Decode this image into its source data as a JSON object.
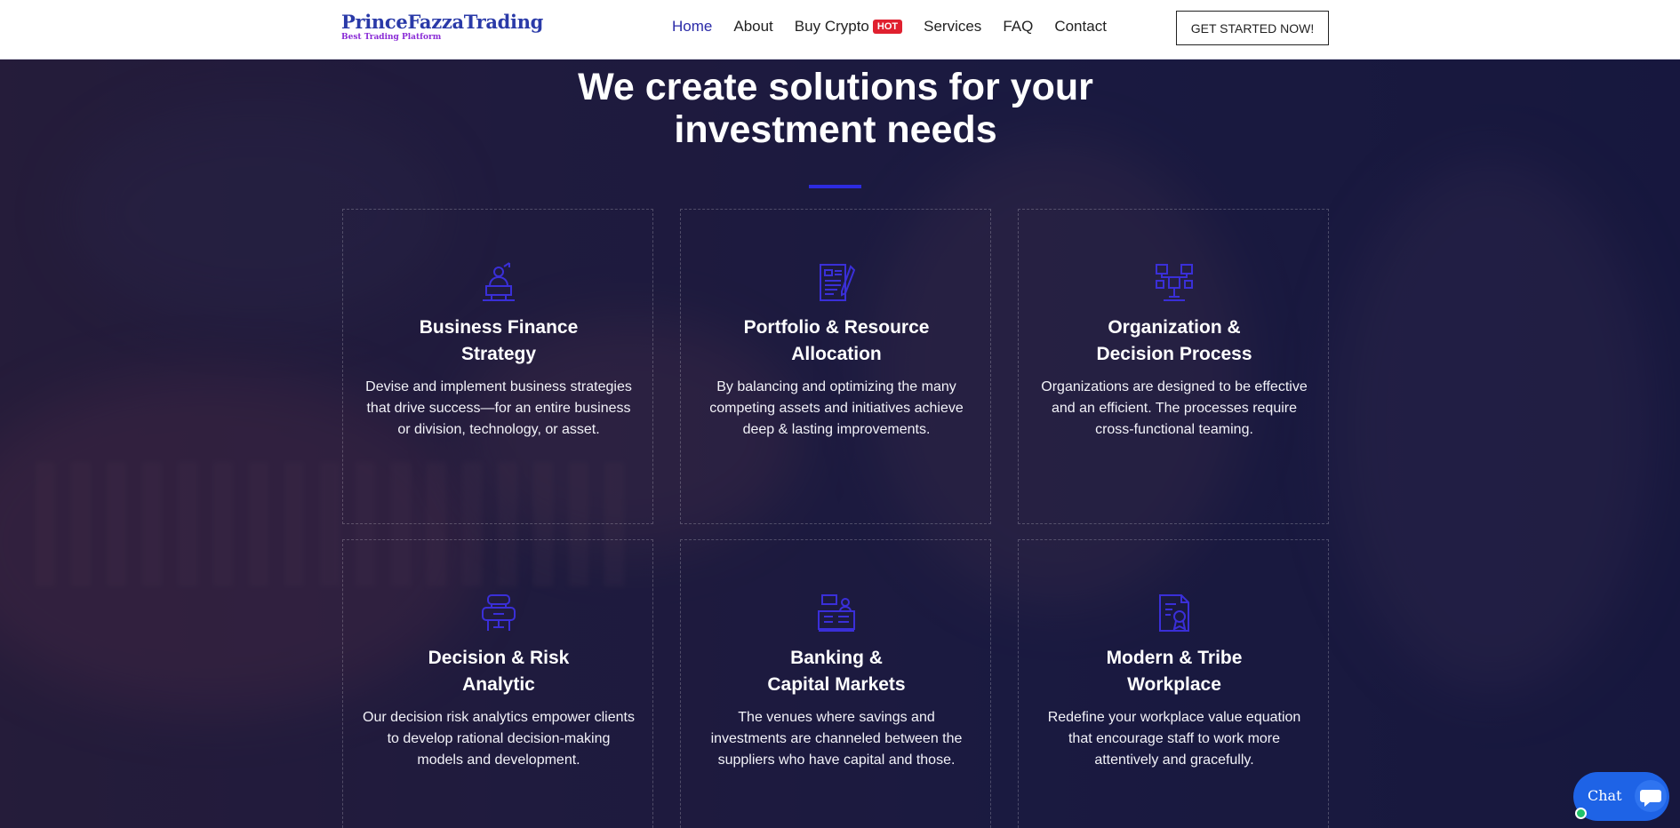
{
  "header": {
    "logo_name": "PrinceFazzaTrading",
    "logo_tagline": "Best Trading Platform",
    "nav": [
      {
        "label": "Home",
        "active": true
      },
      {
        "label": "About"
      },
      {
        "label": "Buy Crypto",
        "badge": "HOT"
      },
      {
        "label": "Services"
      },
      {
        "label": "FAQ"
      },
      {
        "label": "Contact"
      }
    ],
    "cta_label": "GET STARTED NOW!"
  },
  "section": {
    "heading_line1": "We create solutions for your",
    "heading_line2": "investment needs",
    "accent_color": "#2d2be0"
  },
  "cards": [
    {
      "icon": "finance-strategy-icon",
      "title_line1": "Business Finance",
      "title_line2": "Strategy",
      "desc": "Devise and implement business strategies that drive success—for an entire business or division, technology, or asset."
    },
    {
      "icon": "portfolio-icon",
      "title_line1": "Portfolio & Resource",
      "title_line2": "Allocation",
      "desc": "By balancing and optimizing the many competing assets and initiatives achieve deep & lasting improvements."
    },
    {
      "icon": "organization-icon",
      "title_line1": "Organization &",
      "title_line2": "Decision Process",
      "desc": "Organizations are designed to be effective and an efficient. The processes require cross-functional teaming."
    },
    {
      "icon": "risk-analytic-icon",
      "title_line1": "Decision & Risk",
      "title_line2": "Analytic",
      "desc": "Our decision risk analytics empower clients to develop rational decision-making models and development."
    },
    {
      "icon": "banking-icon",
      "title_line1": "Banking &",
      "title_line2": "Capital Markets",
      "desc": "The venues where savings and investments are channeled between the suppliers who have capital and those."
    },
    {
      "icon": "workplace-icon",
      "title_line1": "Modern & Tribe",
      "title_line2": "Workplace",
      "desc": "Redefine your workplace value equation that encourage staff to work more attentively and gracefully."
    }
  ],
  "chat": {
    "label": "Chat",
    "icon": "chat-bubble-icon"
  },
  "colors": {
    "brand": "#2a3aa8",
    "icon": "#3a2fd8",
    "hot_badge": "#e0202f",
    "chat": "#1e63e6",
    "online": "#1fc26a"
  }
}
